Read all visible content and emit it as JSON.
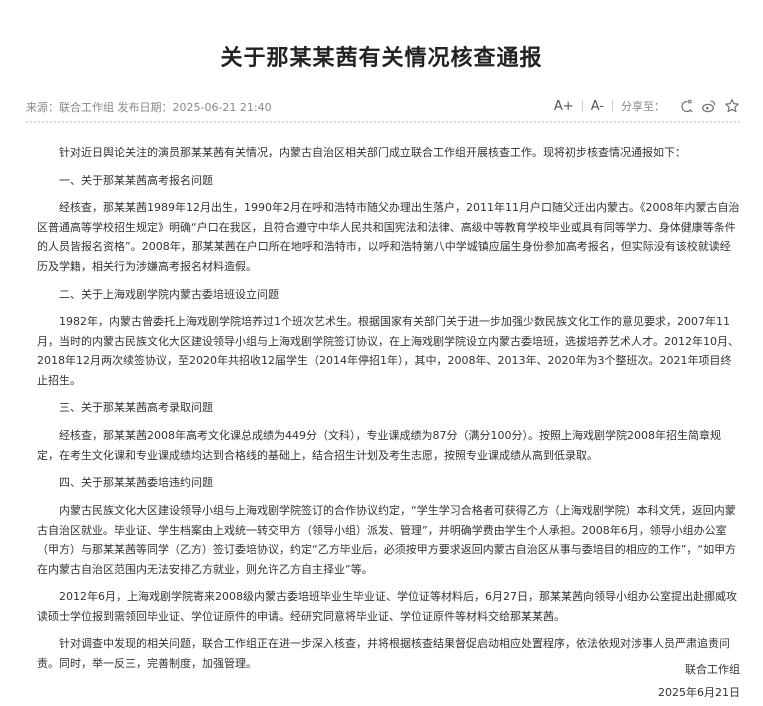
{
  "article": {
    "title": "关于那某某茜有关情况核查通报",
    "meta": {
      "source": "来源：联合工作组  发布日期：2025-06-21 21:40",
      "font_increase": "A+",
      "font_decrease": "A-",
      "share_label": "分享至："
    },
    "paragraphs": [
      "针对近日舆论关注的演员那某某茜有关情况，内蒙古自治区相关部门成立联合工作组开展核查工作。现将初步核查情况通报如下：",
      "一、关于那某某茜高考报名问题",
      "经核查，那某某茜1989年12月出生，1990年2月在呼和浩特市随父办理出生落户，2011年11月户口随父迁出内蒙古。《2008年内蒙古自治区普通高等学校招生规定》明确“户口在我区，且符合遵守中华人民共和国宪法和法律、高级中等教育学校毕业或具有同等学力、身体健康等条件的人员皆报名资格”。2008年，那某某茜在户口所在地呼和浩特市，以呼和浩特第八中学城镇应届生身份参加高考报名，但实际没有该校就读经历及学籍，相关行为涉嫌高考报名材料造假。",
      "二、关于上海戏剧学院内蒙古委培班设立问题",
      "1982年，内蒙古曾委托上海戏剧学院培养过1个班次艺术生。根据国家有关部门关于进一步加强少数民族文化工作的意见要求，2007年11月，当时的内蒙古民族文化大区建设领导小组与上海戏剧学院签订协议，在上海戏剧学院设立内蒙古委培班，选拔培养艺术人才。2012年10月、2018年12月两次续签协议，至2020年共招收12届学生（2014年停招1年），其中，2008年、2013年、2020年为3个整班次。2021年项目终止招生。",
      "三、关于那某某茜高考录取问题",
      "经核查，那某某茜2008年高考文化课总成绩为449分（文科），专业课成绩为87分（满分100分）。按照上海戏剧学院2008年招生简章规定，在考生文化课和专业课成绩均达到合格线的基础上，结合招生计划及考生志愿，按照专业课成绩从高到低录取。",
      "四、关于那某某茜委培违约问题",
      "内蒙古民族文化大区建设领导小组与上海戏剧学院签订的合作协议约定，“学生学习合格者可获得乙方（上海戏剧学院）本科文凭，返回内蒙古自治区就业。毕业证、学生档案由上戏统一转交甲方（领导小组）派发、管理”，并明确学费由学生个人承担。2008年6月，领导小组办公室（甲方）与那某某茜等同学（乙方）签订委培协议，约定“乙方毕业后，必须按甲方要求返回内蒙古自治区从事与委培目的相应的工作”，“如甲方在内蒙古自治区范围内无法安排乙方就业，则允许乙方自主择业”等。",
      "2012年6月，上海戏剧学院寄来2008级内蒙古委培班毕业生毕业证、学位证等材料后，6月27日，那某某茜向领导小组办公室提出赴挪威攻读硕士学位报到需领回毕业证、学位证原件的申请。经研究同意将毕业证、学位证原件等材料交给那某某茜。",
      "针对调查中发现的相关问题，联合工作组正在进一步深入核查，并将根据核查结果督促启动相应处置程序，依法依规对涉事人员严肃追责问责。同时，举一反三，完善制度，加强管理。"
    ],
    "signature": "联合工作组",
    "date": "2025年6月21日"
  },
  "colors": {
    "title": "#222222",
    "body": "#333333",
    "meta": "#888888"
  },
  "icons": [
    "wechat-share-icon",
    "weibo-share-icon",
    "favorite-star-icon"
  ]
}
